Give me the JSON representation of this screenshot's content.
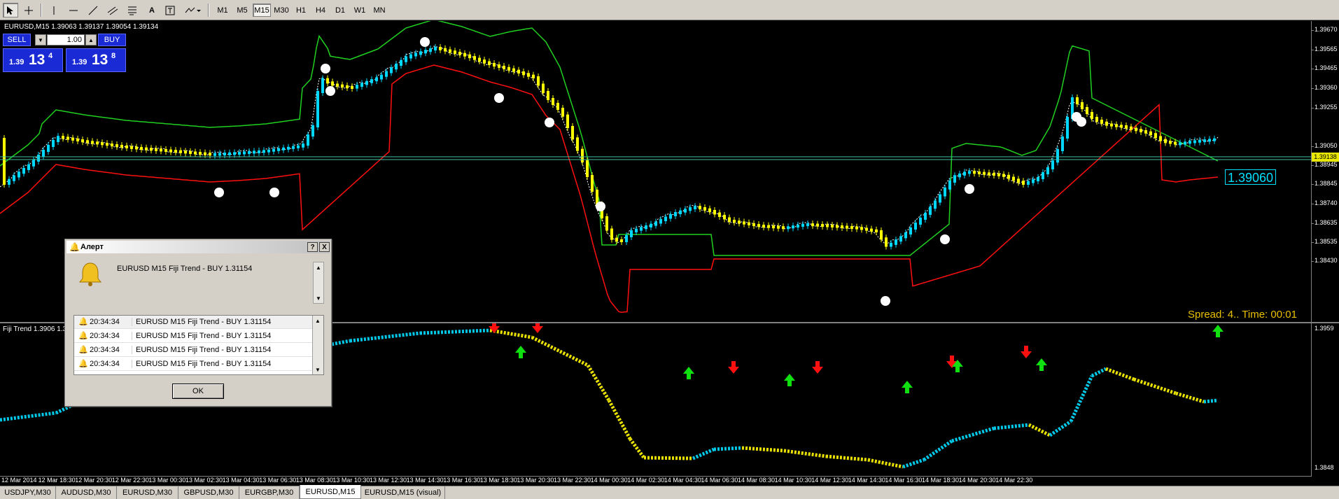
{
  "toolbar": {
    "timeframes": [
      "M1",
      "M5",
      "M15",
      "M30",
      "H1",
      "H4",
      "D1",
      "W1",
      "MN"
    ],
    "active_timeframe": "M15"
  },
  "chart": {
    "symbol_header": "EURUSD,M15  1.39063 1.39137 1.39054 1.39134",
    "price_axis_labels": [
      "1.39670",
      "1.39565",
      "1.39465",
      "1.39360",
      "1.39255",
      "1.39050",
      "1.38945",
      "1.38845",
      "1.38740",
      "1.38635",
      "1.38535",
      "1.38430"
    ],
    "current_price_tag": "1.39138",
    "last_price_box": "1.39060",
    "spread_text": "Spread: 4.. Time: 00:01",
    "indicator_header": "Fiji Trend 1.3906 1.3",
    "indicator_axis_top": "1.3959",
    "indicator_axis_bottom": "1.3848",
    "time_axis_labels": [
      "12 Mar 2014",
      "12 Mar 18:30",
      "12 Mar 20:30",
      "12 Mar 22:30",
      "13 Mar 00:30",
      "13 Mar 02:30",
      "13 Mar 04:30",
      "13 Mar 06:30",
      "13 Mar 08:30",
      "13 Mar 10:30",
      "13 Mar 12:30",
      "13 Mar 14:30",
      "13 Mar 16:30",
      "13 Mar 18:30",
      "13 Mar 20:30",
      "13 Mar 22:30",
      "14 Mar 00:30",
      "14 Mar 02:30",
      "14 Mar 04:30",
      "14 Mar 06:30",
      "14 Mar 08:30",
      "14 Mar 10:30",
      "14 Mar 12:30",
      "14 Mar 14:30",
      "14 Mar 16:30",
      "14 Mar 18:30",
      "14 Mar 20:30",
      "14 Mar 22:30"
    ]
  },
  "trade_panel": {
    "sell_label": "SELL",
    "buy_label": "BUY",
    "lot": "1.00",
    "bid_prefix": "1.39",
    "bid_big": "13",
    "bid_sup": "4",
    "ask_prefix": "1.39",
    "ask_big": "13",
    "ask_sup": "8"
  },
  "alert_dialog": {
    "title": "Алерт",
    "help_label": "?",
    "close_label": "X",
    "message": "EURUSD  M15 Fiji Trend - BUY 1.31154",
    "rows": [
      {
        "time": "20:34:34",
        "text": "EURUSD  M15 Fiji Trend - BUY 1.31154"
      },
      {
        "time": "20:34:34",
        "text": "EURUSD  M15 Fiji Trend - BUY 1.31154"
      },
      {
        "time": "20:34:34",
        "text": "EURUSD  M15 Fiji Trend - BUY 1.31154"
      },
      {
        "time": "20:34:34",
        "text": "EURUSD  M15 Fiji Trend - BUY 1.31154"
      }
    ],
    "ok_label": "OK"
  },
  "tabs": [
    "USDJPY,M30",
    "AUDUSD,M30",
    "EURUSD,M30",
    "GBPUSD,M30",
    "EURGBP,M30",
    "EURUSD,M15",
    "EURUSD,M15 (visual)"
  ],
  "active_tab": "EURUSD,M15",
  "colors": {
    "bull": "#00d8ff",
    "bear": "#ffff00",
    "upper_band": "#20d020",
    "lower_band": "#ff1010",
    "dots": "#ffffff",
    "price_line": "#40c0a0"
  }
}
